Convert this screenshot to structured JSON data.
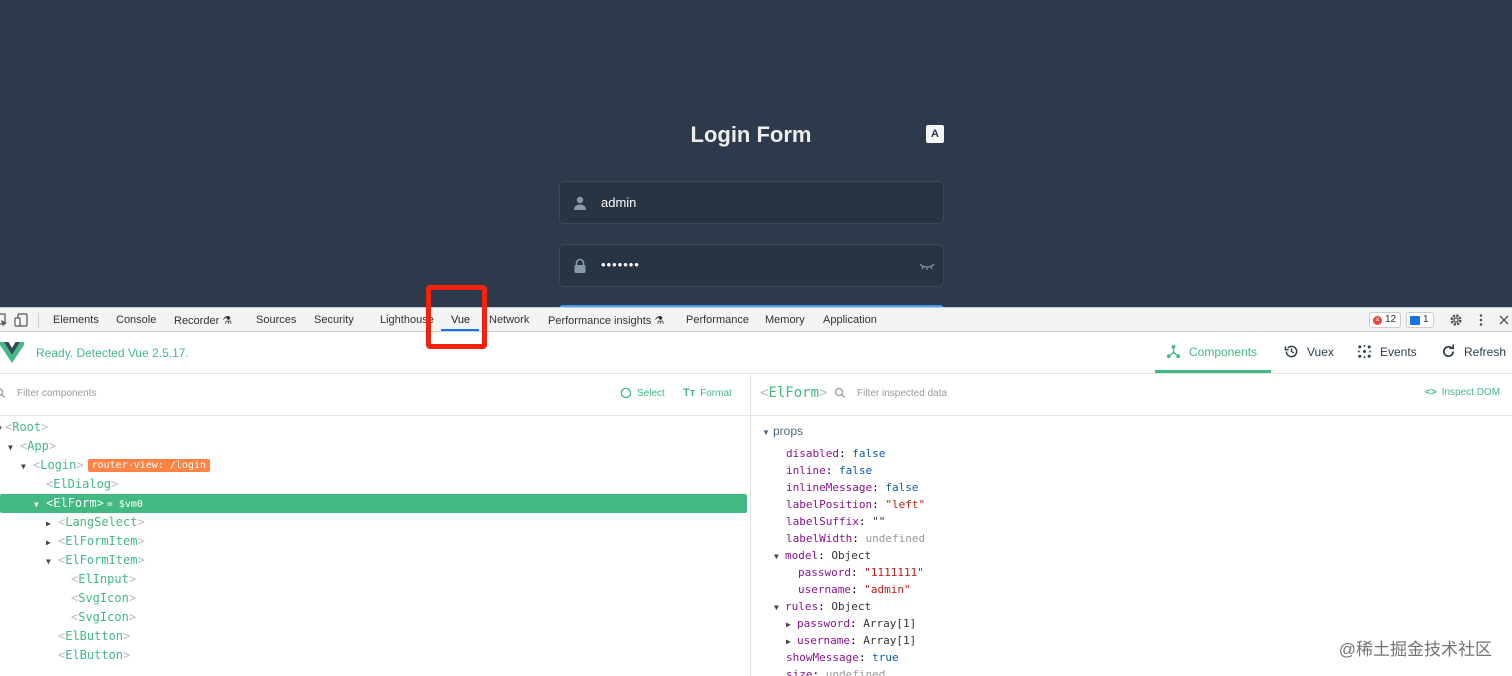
{
  "app": {
    "title": "Login Form",
    "lang_icon_text": "A文",
    "username_value": "admin",
    "password_value": "•••••••"
  },
  "devtools": {
    "tabs": [
      "Elements",
      "Console",
      "Recorder ⚗",
      "Sources",
      "Security",
      "Lighthouse",
      "Vue",
      "Network",
      "Performance insights ⚗",
      "Performance",
      "Memory",
      "Application"
    ],
    "active_tab": "Vue",
    "error_count": "12",
    "message_count": "1"
  },
  "vue_header": {
    "status": "Ready. Detected Vue 2.5.17.",
    "components_label": "Components",
    "vuex_label": "Vuex",
    "events_label": "Events",
    "refresh_label": "Refresh"
  },
  "left_pane": {
    "filter_placeholder": "Filter components",
    "select_label": "Select",
    "format_label": "Format",
    "tree": [
      {
        "name": "Root",
        "depth": 0,
        "arrow": "down"
      },
      {
        "name": "App",
        "depth": 1,
        "arrow": "down"
      },
      {
        "name": "Login",
        "depth": 2,
        "arrow": "down",
        "badge": "router-view: /login"
      },
      {
        "name": "ElDialog",
        "depth": 3,
        "arrow": ""
      },
      {
        "name": "ElForm",
        "depth": 3,
        "arrow": "down",
        "selected": true,
        "suffix": "= $vm0"
      },
      {
        "name": "LangSelect",
        "depth": 4,
        "arrow": "right"
      },
      {
        "name": "ElFormItem",
        "depth": 4,
        "arrow": "right"
      },
      {
        "name": "ElFormItem",
        "depth": 4,
        "arrow": "down"
      },
      {
        "name": "ElInput",
        "depth": 5,
        "arrow": ""
      },
      {
        "name": "SvgIcon",
        "depth": 5,
        "arrow": ""
      },
      {
        "name": "SvgIcon",
        "depth": 5,
        "arrow": ""
      },
      {
        "name": "ElButton",
        "depth": 4,
        "arrow": ""
      },
      {
        "name": "ElButton",
        "depth": 4,
        "arrow": ""
      }
    ]
  },
  "right_pane": {
    "inspected": "ElForm",
    "filter_placeholder": "Filter inspected data",
    "inspect_dom_label": "Inspect DOM",
    "section": "props",
    "props": [
      {
        "key": "disabled",
        "value": "false",
        "type": "bool",
        "depth": 0
      },
      {
        "key": "inline",
        "value": "false",
        "type": "bool",
        "depth": 0
      },
      {
        "key": "inlineMessage",
        "value": "false",
        "type": "bool",
        "depth": 0
      },
      {
        "key": "labelPosition",
        "value": "\"left\"",
        "type": "str",
        "depth": 0
      },
      {
        "key": "labelSuffix",
        "value": "\"\"",
        "type": "obj",
        "depth": 0
      },
      {
        "key": "labelWidth",
        "value": "undefined",
        "type": "undef",
        "depth": 0
      },
      {
        "key": "model",
        "value": "Object",
        "type": "obj",
        "depth": 0,
        "arrow": "down"
      },
      {
        "key": "password",
        "value": "\"1111111\"",
        "type": "str",
        "depth": 1
      },
      {
        "key": "username",
        "value": "\"admin\"",
        "type": "str",
        "depth": 1
      },
      {
        "key": "rules",
        "value": "Object",
        "type": "obj",
        "depth": 0,
        "arrow": "down"
      },
      {
        "key": "password",
        "value": "Array[1]",
        "type": "obj",
        "depth": 1,
        "arrow": "right"
      },
      {
        "key": "username",
        "value": "Array[1]",
        "type": "obj",
        "depth": 1,
        "arrow": "right"
      },
      {
        "key": "showMessage",
        "value": "true",
        "type": "bool",
        "depth": 0
      },
      {
        "key": "size",
        "value": "undefined",
        "type": "undef",
        "depth": 0
      }
    ]
  },
  "watermark": "@稀土掘金技术社区",
  "colors": {
    "vue_green": "#42b983",
    "app_bg": "#2d3a4b",
    "highlight": "#f4220b"
  }
}
